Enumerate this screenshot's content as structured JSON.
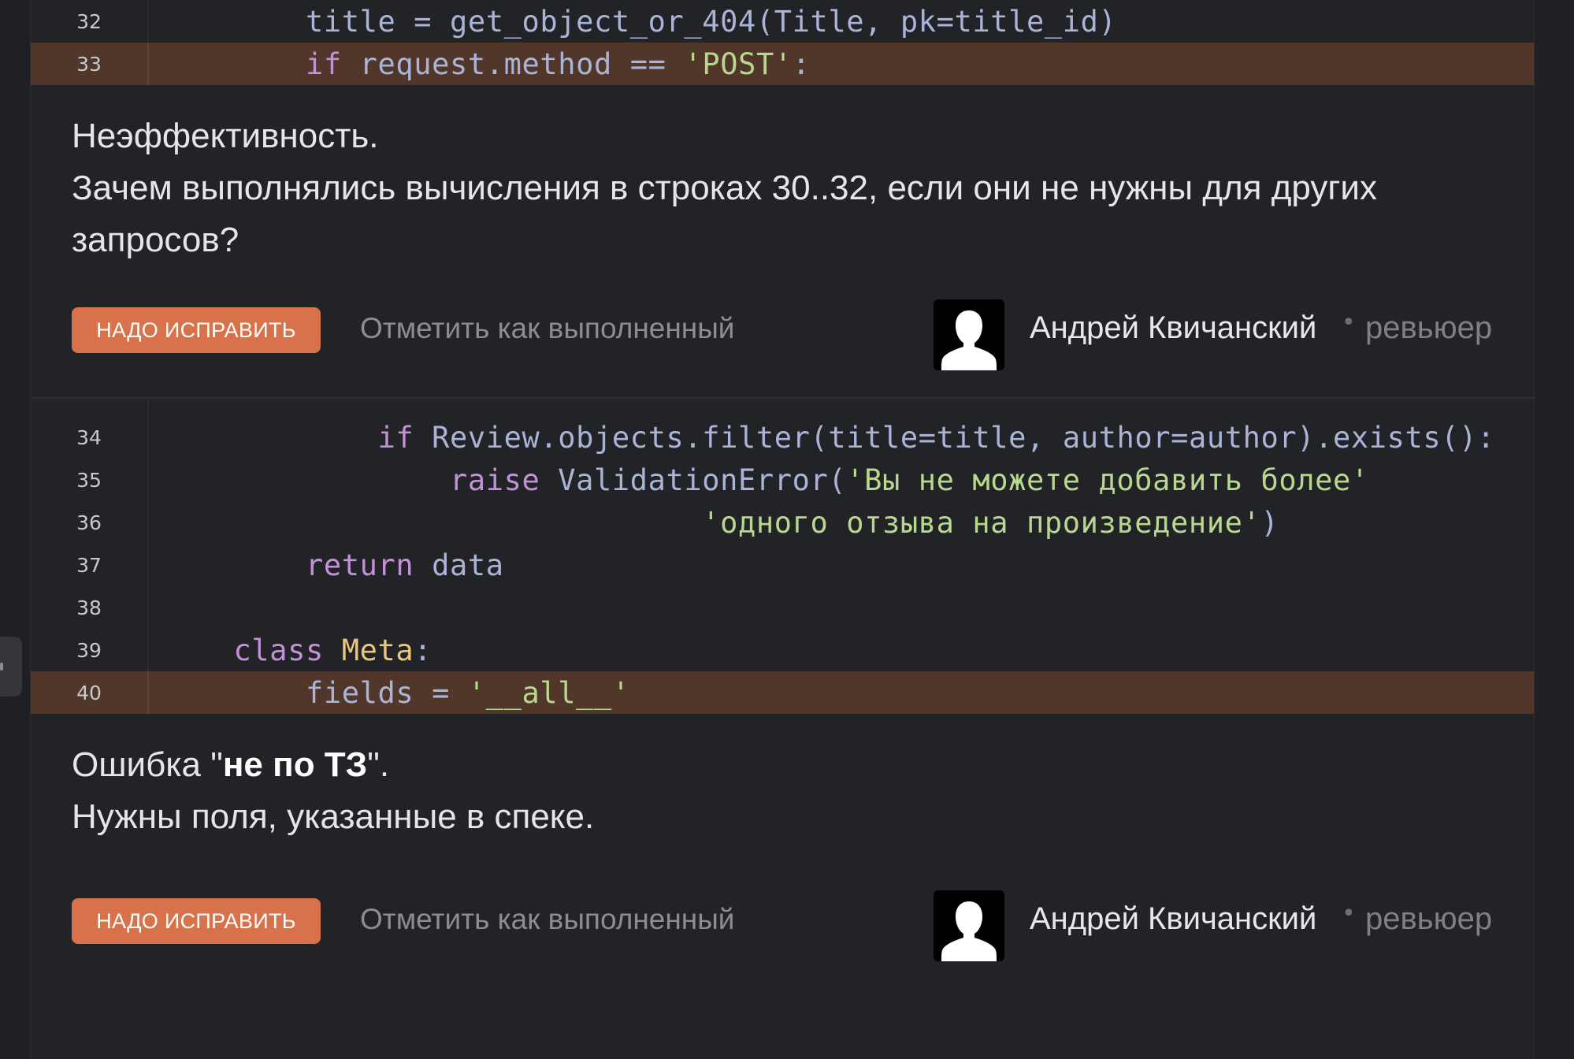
{
  "block1": {
    "lines": [
      {
        "num": "32",
        "segments": [
          {
            "t": "        title = get_object_or_404(Title, pk=title_id)",
            "c": ""
          }
        ]
      },
      {
        "num": "33",
        "highlight": true,
        "segments": [
          {
            "t": "        ",
            "c": ""
          },
          {
            "t": "if",
            "c": "kw"
          },
          {
            "t": " request.method == ",
            "c": ""
          },
          {
            "t": "'POST'",
            "c": "str"
          },
          {
            "t": ":",
            "c": ""
          }
        ]
      }
    ]
  },
  "comment1": {
    "lines": [
      "Неэффективность.",
      "Зачем выполнялись вычисления в строках 30..32, если они не нужны для других",
      "запросов?"
    ],
    "fix_label": "НАДО ИСПРАВИТЬ",
    "mark_label": "Отметить как выполненный",
    "author": "Андрей Квичанский",
    "dot": "•",
    "role": "ревьюер"
  },
  "block2": {
    "lines": [
      {
        "num": "34",
        "segments": [
          {
            "t": "            ",
            "c": ""
          },
          {
            "t": "if",
            "c": "kw"
          },
          {
            "t": " Review.objects.filter(title=title, author=author).exists():",
            "c": ""
          }
        ]
      },
      {
        "num": "35",
        "segments": [
          {
            "t": "                ",
            "c": ""
          },
          {
            "t": "raise",
            "c": "kw"
          },
          {
            "t": " ValidationError(",
            "c": ""
          },
          {
            "t": "'Вы не можете добавить более'",
            "c": "str"
          }
        ]
      },
      {
        "num": "36",
        "segments": [
          {
            "t": "                              ",
            "c": ""
          },
          {
            "t": "'одного отзыва на произведение'",
            "c": "str"
          },
          {
            "t": ")",
            "c": ""
          }
        ]
      },
      {
        "num": "37",
        "segments": [
          {
            "t": "        ",
            "c": ""
          },
          {
            "t": "return",
            "c": "kw"
          },
          {
            "t": " data",
            "c": ""
          }
        ]
      },
      {
        "num": "38",
        "segments": [
          {
            "t": "",
            "c": ""
          }
        ]
      },
      {
        "num": "39",
        "segments": [
          {
            "t": "    ",
            "c": ""
          },
          {
            "t": "class",
            "c": "kw"
          },
          {
            "t": " ",
            "c": ""
          },
          {
            "t": "Meta",
            "c": "cls"
          },
          {
            "t": ":",
            "c": ""
          }
        ]
      },
      {
        "num": "40",
        "highlight": true,
        "segments": [
          {
            "t": "        fields = ",
            "c": ""
          },
          {
            "t": "'__all__'",
            "c": "str"
          }
        ]
      }
    ]
  },
  "comment2": {
    "line1_prefix": "Ошибка \"",
    "line1_bold": "не по ТЗ",
    "line1_suffix": "\".",
    "line2": "Нужны поля, указанные в спеке.",
    "fix_label": "НАДО ИСПРАВИТЬ",
    "mark_label": "Отметить как выполненный",
    "author": "Андрей Квичанский",
    "dot": "•",
    "role": "ревьюер"
  },
  "icons": {
    "avatar": "user-silhouette-icon"
  }
}
